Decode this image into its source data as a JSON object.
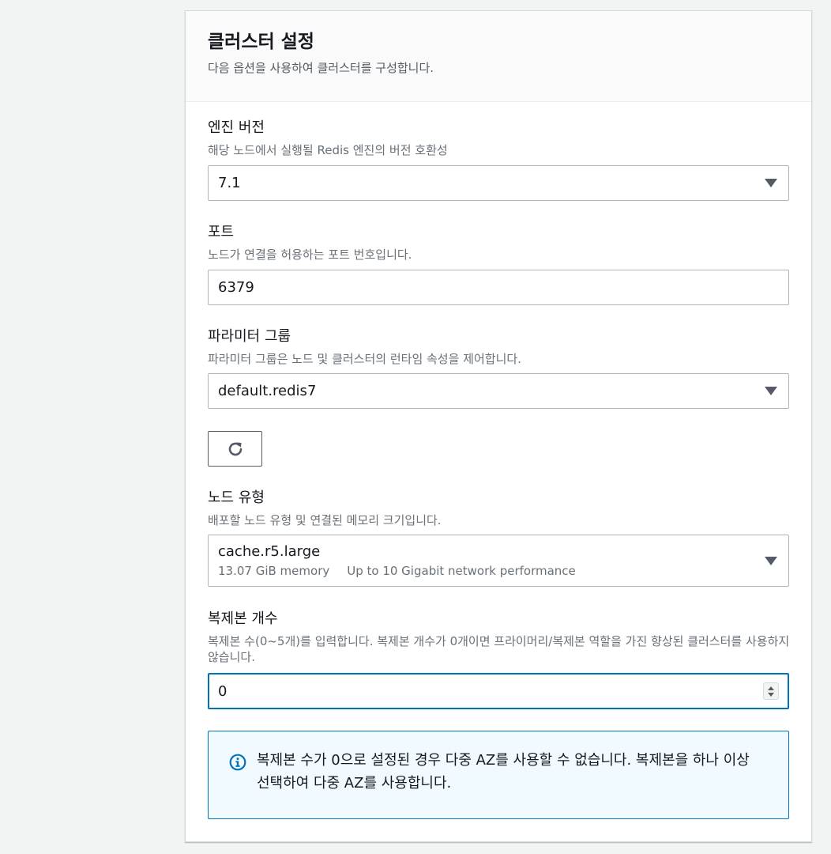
{
  "panel": {
    "title": "클러스터 설정",
    "description": "다음 옵션을 사용하여 클러스터를 구성합니다."
  },
  "engine_version": {
    "label": "엔진 버전",
    "description": "해당 노드에서 실행될 Redis 엔진의 버전 호환성",
    "selected": "7.1"
  },
  "port": {
    "label": "포트",
    "description": "노드가 연결을 허용하는 포트 번호입니다.",
    "value": "6379"
  },
  "parameter_group": {
    "label": "파라미터 그룹",
    "description": "파라미터 그룹은 노드 및 클러스터의 런타임 속성을 제어합니다.",
    "selected": "default.redis7",
    "refresh_icon": "refresh-icon"
  },
  "node_type": {
    "label": "노드 유형",
    "description": "배포할 노드 유형 및 연결된 메모리 크기입니다.",
    "selected": "cache.r5.large",
    "memory": "13.07 GiB memory",
    "network": "Up to 10 Gigabit network performance"
  },
  "replicas": {
    "label": "복제본 개수",
    "description": "복제본 수(0~5개)를 입력합니다. 복제본 개수가 0개이면 프라이머리/복제본 역할을 가진 향상된 클러스터를 사용하지 않습니다.",
    "value": "0"
  },
  "info": {
    "icon": "info-icon",
    "text": "복제본 수가 0으로 설정된 경우 다중 AZ를 사용할 수 없습니다. 복제본을 하나 이상 선택하여 다중 AZ를 사용합니다."
  },
  "colors": {
    "accent": "#0073bb",
    "info_background": "#f1faff",
    "border": "#aab7b8"
  }
}
